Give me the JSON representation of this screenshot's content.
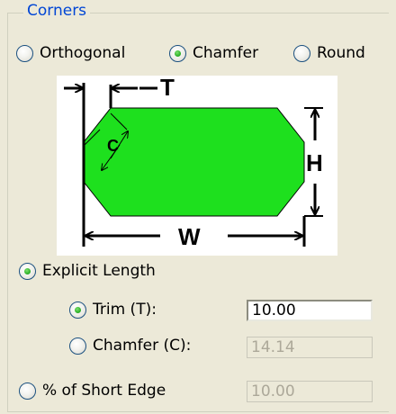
{
  "group": {
    "title": "Corners",
    "corner_types": [
      {
        "label": "Orthogonal",
        "checked": false
      },
      {
        "label": "Chamfer",
        "checked": true
      },
      {
        "label": "Round",
        "checked": false
      }
    ],
    "figure": {
      "trim_label": "T",
      "chamfer_label": "C",
      "height_label": "H",
      "width_label": "W",
      "shape_color": "#1ee01e"
    },
    "explicit_length": {
      "label": "Explicit Length",
      "checked": true
    },
    "trim": {
      "label": "Trim (T):",
      "checked": true,
      "value": "10.00"
    },
    "chamfer": {
      "label": "Chamfer (C):",
      "checked": false,
      "value": "14.14"
    },
    "short_edge": {
      "label": "% of Short Edge",
      "checked": false,
      "value": "10.00"
    }
  }
}
